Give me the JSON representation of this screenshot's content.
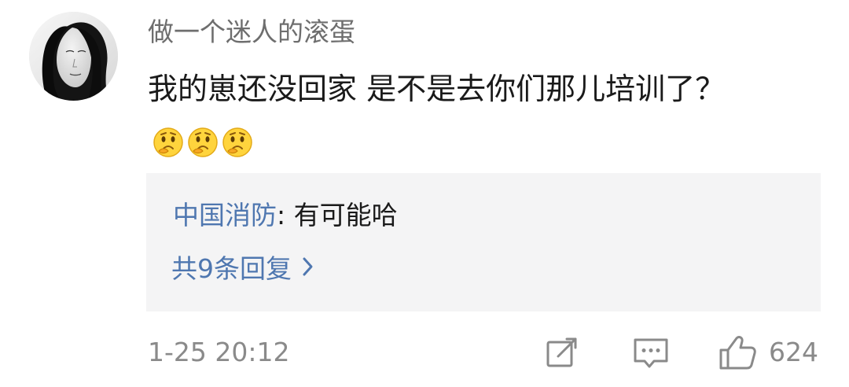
{
  "comment": {
    "username": "做一个迷人的滚蛋",
    "text": "我的崽还没回家  是不是去你们那儿培训了？",
    "emoji_icons": [
      "thinking-face-icon",
      "thinking-face-icon",
      "thinking-face-icon"
    ],
    "timestamp": "1-25 20:12",
    "like_count": "624"
  },
  "reply_box": {
    "author": "中国消防",
    "separator": ": ",
    "text": "有可能哈",
    "more_replies": "共9条回复",
    "chevron_icon": "chevron-right-icon"
  },
  "colors": {
    "username": "#6e6e6e",
    "text": "#1a1a1a",
    "reply_author": "#4f77b0",
    "reply_background": "#f4f4f5",
    "meta": "#8a8a8a"
  },
  "icons": {
    "avatar": "avatar",
    "share": "share-icon",
    "comment": "comment-icon",
    "like": "thumbs-up-icon"
  }
}
